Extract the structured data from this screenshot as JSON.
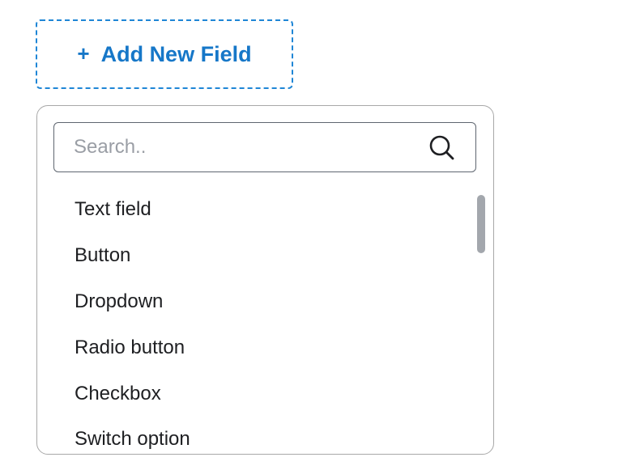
{
  "add_field_button": {
    "icon": "plus-icon",
    "icon_glyph": "+",
    "label": "Add New Field"
  },
  "dropdown": {
    "search": {
      "placeholder": "Search..",
      "value": "",
      "icon": "search-icon"
    },
    "options": [
      {
        "label": "Text field"
      },
      {
        "label": "Button"
      },
      {
        "label": "Dropdown"
      },
      {
        "label": "Radio button"
      },
      {
        "label": "Checkbox"
      },
      {
        "label": "Switch option"
      }
    ]
  },
  "colors": {
    "accent": "#1677c8",
    "dashed_border": "#1f86d6",
    "panel_border": "#a8a8a8",
    "search_border": "#5f6670",
    "placeholder": "#9a9ea5",
    "text": "#1e1f22",
    "scrollbar_thumb": "#a3a7ad"
  }
}
